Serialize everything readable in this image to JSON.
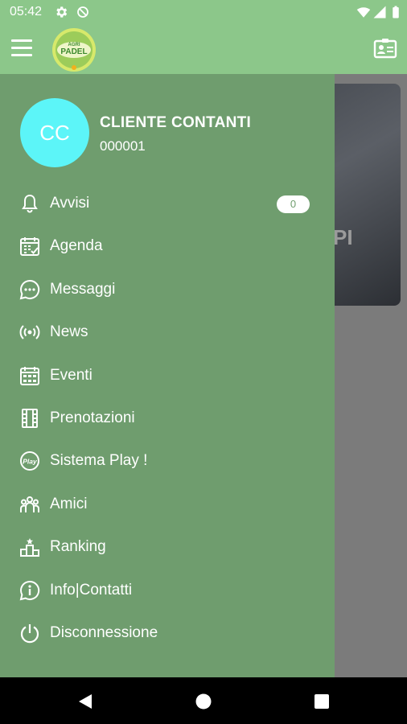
{
  "status_bar": {
    "time": "05:42"
  },
  "app_bar": {
    "logo_text_top": "AGRI",
    "logo_text_main": "PADEL"
  },
  "background": {
    "card_text": "PI"
  },
  "user": {
    "initials": "CC",
    "name": "CLIENTE CONTANTI",
    "code": "000001"
  },
  "menu": {
    "items": [
      {
        "label": "Avvisi",
        "icon": "bell-icon",
        "badge": "0"
      },
      {
        "label": "Agenda",
        "icon": "calendar-check-icon"
      },
      {
        "label": "Messaggi",
        "icon": "chat-bubble-icon"
      },
      {
        "label": "News",
        "icon": "broadcast-icon"
      },
      {
        "label": "Eventi",
        "icon": "calendar-grid-icon"
      },
      {
        "label": "Prenotazioni",
        "icon": "film-booking-icon"
      },
      {
        "label": "Sistema Play !",
        "icon": "play-badge-icon"
      },
      {
        "label": "Amici",
        "icon": "people-group-icon"
      },
      {
        "label": "Ranking",
        "icon": "podium-icon"
      },
      {
        "label": "Info|Contatti",
        "icon": "info-circle-icon"
      },
      {
        "label": "Disconnessione",
        "icon": "power-icon"
      }
    ]
  },
  "colors": {
    "app_bar": "#8cc78a",
    "drawer": "#6f9d6e",
    "avatar": "#5cf5f8"
  }
}
